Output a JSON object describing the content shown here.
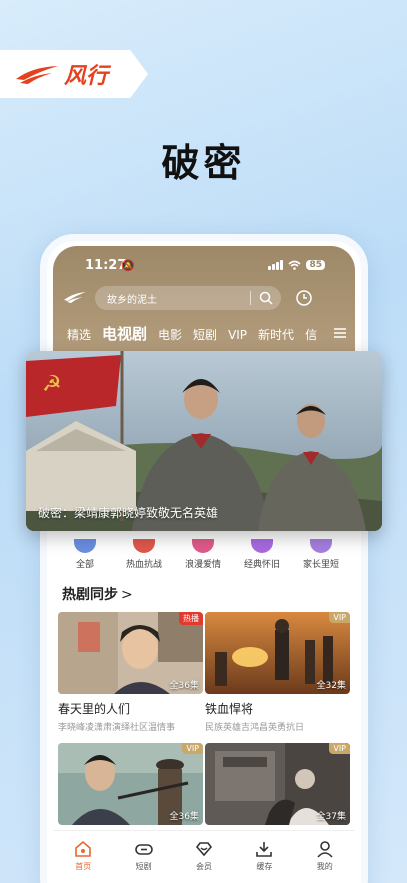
{
  "brand": {
    "name": "风行",
    "accent": "#e4421e"
  },
  "headline": "破密",
  "status_bar": {
    "time": "11:27",
    "battery": "85"
  },
  "search": {
    "query": "故乡的泥土"
  },
  "tabs": [
    {
      "label": "精选",
      "active": false
    },
    {
      "label": "电视剧",
      "active": true
    },
    {
      "label": "电影",
      "active": false
    },
    {
      "label": "短剧",
      "active": false
    },
    {
      "label": "VIP",
      "active": false
    },
    {
      "label": "新时代",
      "active": false
    },
    {
      "label": "信",
      "active": false
    }
  ],
  "banner": {
    "caption": "破密：梁靖康郭晓婷致敬无名英雄"
  },
  "categories": [
    {
      "label": "全部",
      "color": "#6a8fe0"
    },
    {
      "label": "热血抗战",
      "color": "#e0574a"
    },
    {
      "label": "浪漫爱情",
      "color": "#e05a8a"
    },
    {
      "label": "经典怀旧",
      "color": "#a86ae0"
    },
    {
      "label": "家长里短",
      "color": "#a57ee0"
    }
  ],
  "section": {
    "title": "热剧同步",
    "arrow": ">"
  },
  "cards": [
    {
      "title": "春天里的人们",
      "subtitle": "李晓峰凌潇肃演绎社区温情事",
      "badge": "热播",
      "badge_type": "hot",
      "episodes": "全36集"
    },
    {
      "title": "铁血悍将",
      "subtitle": "民族英雄吉鸿昌英勇抗日",
      "badge": "VIP",
      "badge_type": "vip",
      "episodes": "全32集"
    },
    {
      "title": "",
      "subtitle": "",
      "badge": "VIP",
      "badge_type": "vip",
      "episodes": "全36集"
    },
    {
      "title": "",
      "subtitle": "",
      "badge": "VIP",
      "badge_type": "vip",
      "episodes": "全37集"
    }
  ],
  "bottom_nav": [
    {
      "label": "首页",
      "icon": "home-icon",
      "active": true
    },
    {
      "label": "短剧",
      "icon": "link-icon",
      "active": false
    },
    {
      "label": "会员",
      "icon": "diamond-icon",
      "active": false
    },
    {
      "label": "缓存",
      "icon": "download-icon",
      "active": false
    },
    {
      "label": "我的",
      "icon": "user-icon",
      "active": false
    }
  ]
}
